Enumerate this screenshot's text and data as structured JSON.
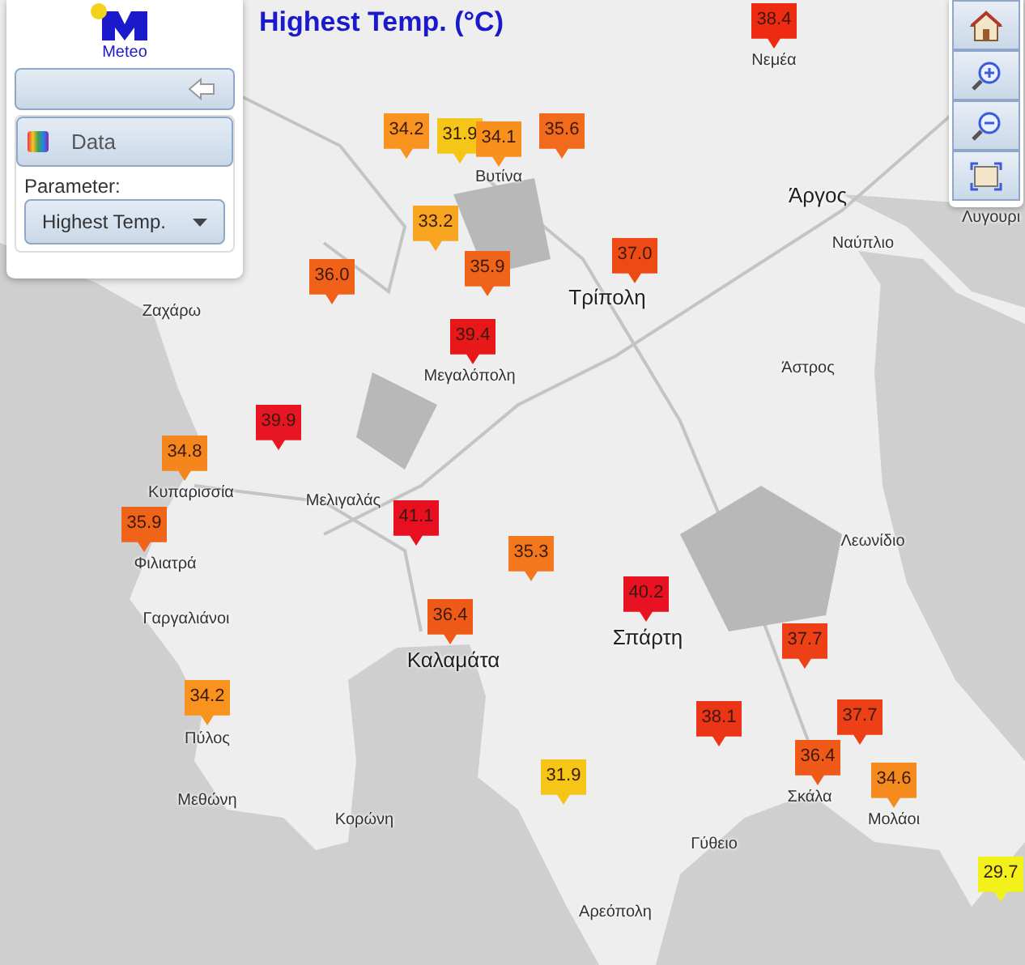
{
  "title": "Highest Temp. (°C)",
  "logo": {
    "text": "Meteo"
  },
  "panel": {
    "data_header": "Data",
    "parameter_label": "Parameter:",
    "parameter_select": {
      "value": "Highest Temp."
    }
  },
  "markers": [
    {
      "value": "38.4",
      "color": "#ee2a10"
    },
    {
      "value": "34.2",
      "color": "#f7931e"
    },
    {
      "value": "31.9",
      "color": "#f5c518"
    },
    {
      "value": "34.1",
      "color": "#f7901c"
    },
    {
      "value": "35.6",
      "color": "#f26a1b"
    },
    {
      "value": "33.2",
      "color": "#f8a521"
    },
    {
      "value": "35.9",
      "color": "#f0641a"
    },
    {
      "value": "36.0",
      "color": "#f0621a"
    },
    {
      "value": "37.0",
      "color": "#ee4a16"
    },
    {
      "value": "39.4",
      "color": "#e8181a"
    },
    {
      "value": "39.9",
      "color": "#e81522"
    },
    {
      "value": "34.8",
      "color": "#f5861e"
    },
    {
      "value": "35.9",
      "color": "#f0641a"
    },
    {
      "value": "41.1",
      "color": "#e80f20"
    },
    {
      "value": "35.3",
      "color": "#f3781d"
    },
    {
      "value": "40.2",
      "color": "#e81222"
    },
    {
      "value": "36.4",
      "color": "#f05a18"
    },
    {
      "value": "37.7",
      "color": "#ee4017"
    },
    {
      "value": "34.2",
      "color": "#f7931e"
    },
    {
      "value": "38.1",
      "color": "#ec3416"
    },
    {
      "value": "37.7",
      "color": "#ee4017"
    },
    {
      "value": "36.4",
      "color": "#f05a18"
    },
    {
      "value": "34.6",
      "color": "#f58a1e"
    },
    {
      "value": "31.9",
      "color": "#f5c518"
    },
    {
      "value": "29.7",
      "color": "#f2f21a"
    }
  ],
  "places": [
    {
      "name": "Νεμέα",
      "kind": "village"
    },
    {
      "name": "Βυτίνα",
      "kind": "village"
    },
    {
      "name": "Τρίπολη",
      "kind": "town"
    },
    {
      "name": "Άργος",
      "kind": "town"
    },
    {
      "name": "Ναύπλιο",
      "kind": "village"
    },
    {
      "name": "Λυγουρι",
      "kind": "village"
    },
    {
      "name": "Ζαχάρω",
      "kind": "village"
    },
    {
      "name": "Μεγαλόπολη",
      "kind": "village"
    },
    {
      "name": "Άστρος",
      "kind": "village"
    },
    {
      "name": "Κυπαρισσία",
      "kind": "village"
    },
    {
      "name": "Μελιγαλάς",
      "kind": "village"
    },
    {
      "name": "Φιλιατρά",
      "kind": "village"
    },
    {
      "name": "Λεωνίδιο",
      "kind": "village"
    },
    {
      "name": "Γαργαλιάνοι",
      "kind": "village"
    },
    {
      "name": "Καλαμάτα",
      "kind": "town"
    },
    {
      "name": "Σπάρτη",
      "kind": "town"
    },
    {
      "name": "Πύλος",
      "kind": "village"
    },
    {
      "name": "Σκάλα",
      "kind": "village"
    },
    {
      "name": "Μολάοι",
      "kind": "village"
    },
    {
      "name": "Μεθώνη",
      "kind": "village"
    },
    {
      "name": "Κορώνη",
      "kind": "village"
    },
    {
      "name": "Γύθειο",
      "kind": "village"
    },
    {
      "name": "Αρεόπολη",
      "kind": "village"
    }
  ]
}
